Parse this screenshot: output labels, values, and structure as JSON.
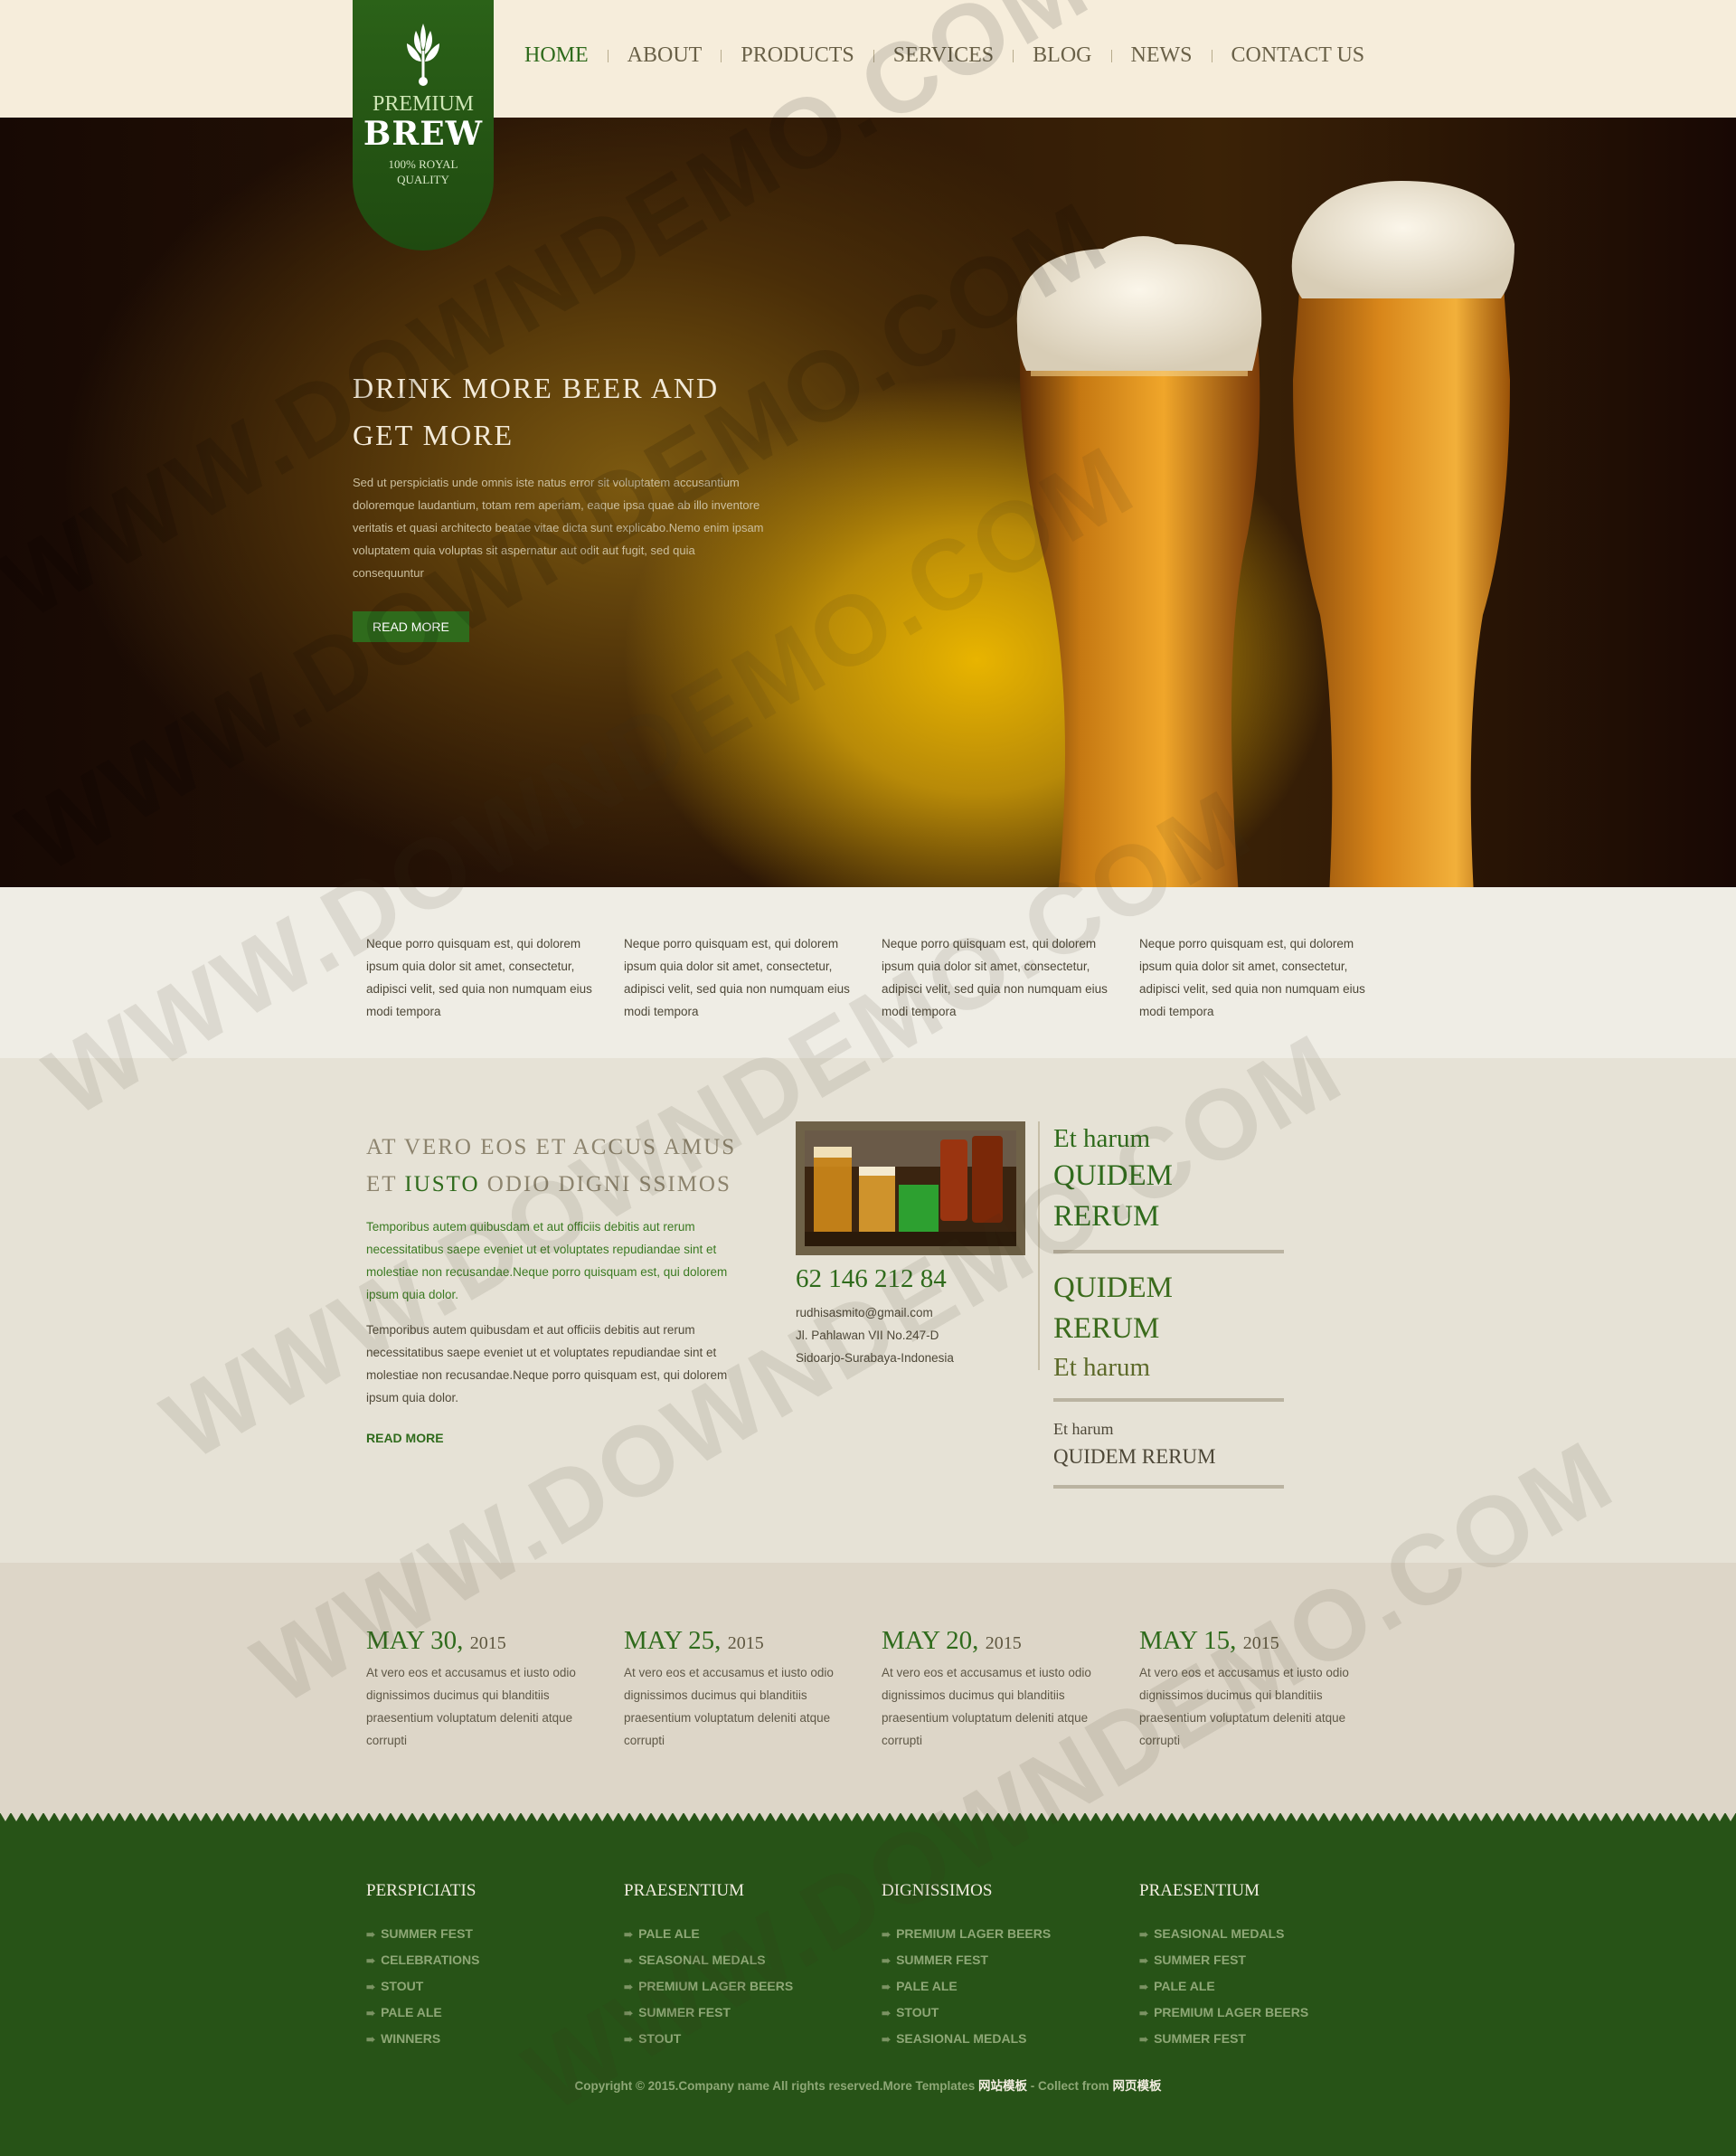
{
  "brand": {
    "line1": "PREMIUM",
    "line2": "BREW",
    "line3": "100% ROYAL QUALITY"
  },
  "nav": [
    {
      "label": "HOME",
      "active": true
    },
    {
      "label": "ABOUT"
    },
    {
      "label": "PRODUCTS"
    },
    {
      "label": "SERVICES"
    },
    {
      "label": "BLOG"
    },
    {
      "label": "NEWS"
    },
    {
      "label": "CONTACT US"
    }
  ],
  "hero": {
    "title_line1": "DRINK MORE BEER AND",
    "title_line2": "GET MORE",
    "body": "Sed ut perspiciatis unde omnis iste natus error sit voluptatem accusantium doloremque laudantium, totam rem aperiam, eaque ipsa quae ab illo inventore veritatis et quasi architecto beatae vitae dicta sunt explicabo.Nemo enim ipsam voluptatem quia voluptas sit aspernatur aut odit aut fugit, sed quia consequuntur",
    "button": "READ MORE"
  },
  "features": [
    "Neque porro quisquam est, qui dolorem ipsum quia dolor sit amet, consectetur, adipisci velit, sed quia non numquam eius modi tempora",
    "Neque porro quisquam est, qui dolorem ipsum quia dolor sit amet, consectetur, adipisci velit, sed quia non numquam eius modi tempora",
    "Neque porro quisquam est, qui dolorem ipsum quia dolor sit amet, consectetur, adipisci velit, sed quia non numquam eius modi tempora",
    "Neque porro quisquam est, qui dolorem ipsum quia dolor sit amet, consectetur, adipisci velit, sed quia non numquam eius modi tempora"
  ],
  "about": {
    "heading_line1": "AT VERO EOS ET ACCUS AMUS",
    "heading_line2_pre": "ET ",
    "heading_line2_accent": "IUSTO",
    "heading_line2_post": " ODIO DIGNI SSIMOS",
    "para_green": "Temporibus autem quibusdam et aut officiis debitis aut rerum necessitatibus saepe eveniet ut et voluptates repudiandae sint et molestiae non recusandae.Neque porro quisquam est, qui dolorem ipsum quia dolor.",
    "para_plain": "Temporibus autem quibusdam et aut officiis debitis aut rerum necessitatibus saepe eveniet ut et voluptates repudiandae sint et molestiae non recusandae.Neque porro quisquam est, qui dolorem ipsum quia dolor.",
    "read_more": "READ MORE"
  },
  "contact": {
    "phone": "62 146 212 84",
    "email": "rudhisasmito@gmail.com",
    "address1": "Jl. Pahlawan VII No.247-D",
    "address2": "Sidoarjo-Surabaya-Indonesia"
  },
  "sidebar": {
    "block1_a": "Et harum",
    "block1_b": "QUIDEM",
    "block1_c": "RERUM",
    "block2_a": "QUIDEM",
    "block2_b": "RERUM",
    "block2_c": "Et harum",
    "block3_a": "Et harum",
    "block3_b": "QUIDEM RERUM"
  },
  "news": [
    {
      "date": "MAY 30,",
      "year": "2015",
      "text": "At vero eos et accusamus et iusto odio dignissimos ducimus qui blanditiis praesentium voluptatum deleniti atque corrupti"
    },
    {
      "date": "MAY 25,",
      "year": "2015",
      "text": "At vero eos et accusamus et iusto odio dignissimos ducimus qui blanditiis praesentium voluptatum deleniti atque corrupti"
    },
    {
      "date": "MAY 20,",
      "year": "2015",
      "text": "At vero eos et accusamus et iusto odio dignissimos ducimus qui blanditiis praesentium voluptatum deleniti atque corrupti"
    },
    {
      "date": "MAY 15,",
      "year": "2015",
      "text": "At vero eos et accusamus et iusto odio dignissimos ducimus qui blanditiis praesentium voluptatum deleniti atque corrupti"
    }
  ],
  "footer": {
    "columns": [
      {
        "title": "PERSPICIATIS",
        "links": [
          "SUMMER FEST",
          "CELEBRATIONS",
          "STOUT",
          "PALE ALE",
          "WINNERS"
        ]
      },
      {
        "title": "PRAESENTIUM",
        "links": [
          "PALE ALE",
          "SEASONAL MEDALS",
          "PREMIUM LAGER BEERS",
          "SUMMER FEST",
          "STOUT"
        ]
      },
      {
        "title": "DIGNISSIMOS",
        "links": [
          "PREMIUM LAGER BEERS",
          "SUMMER FEST",
          "PALE ALE",
          "STOUT",
          "SEASIONAL MEDALS"
        ]
      },
      {
        "title": "PRAESENTIUM",
        "links": [
          "SEASIONAL MEDALS",
          "SUMMER FEST",
          "PALE ALE",
          "PREMIUM LAGER BEERS",
          "SUMMER FEST"
        ]
      }
    ],
    "copyright": "Copyright © 2015.Company name All rights reserved.More Templates ",
    "link1": "网站模板",
    "mid": " - Collect from ",
    "link2": "网页模板"
  },
  "watermark": "WWW.DOWNDEMO.COM",
  "colors": {
    "accent_green": "#2f6b1c",
    "header_bg": "#f6eddb",
    "footer_bg": "#275317"
  }
}
